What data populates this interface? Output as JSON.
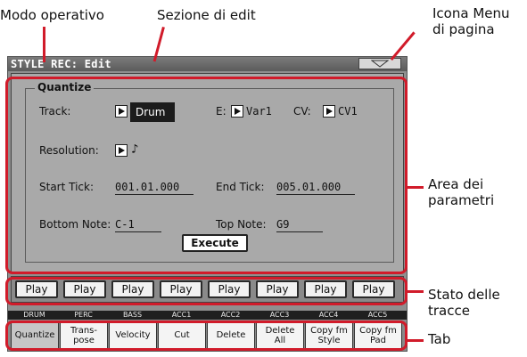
{
  "annotations": {
    "modo": "Modo operativo",
    "sezione": "Sezione di edit",
    "icona_line1": "Icona Menu",
    "icona_line2": "di pagina",
    "area_line1": "Area dei",
    "area_line2": "parametri",
    "stato_line1": "Stato delle",
    "stato_line2": "tracce",
    "tab": "Tab"
  },
  "colors": {
    "callout": "#d11b2a",
    "screen_bg": "#a9a9a9",
    "title_bg": "#6a6a6a"
  },
  "window": {
    "title": "STYLE REC: Edit",
    "menu_icon": "triangle-down-icon"
  },
  "quantize": {
    "group_title": "Quantize",
    "track_label": "Track:",
    "track_value": "Drum",
    "e_label": "E:",
    "e_value": "Var1",
    "cv_label": "CV:",
    "cv_value": "CV1",
    "resolution_label": "Resolution:",
    "resolution_value": "♪",
    "start_tick_label": "Start Tick:",
    "start_tick_value": "001.01.000",
    "end_tick_label": "End Tick:",
    "end_tick_value": "005.01.000",
    "bottom_note_label": "Bottom Note:",
    "bottom_note_value": "C-1",
    "top_note_label": "Top Note:",
    "top_note_value": "G9",
    "execute_label": "Execute"
  },
  "play_buttons": [
    "Play",
    "Play",
    "Play",
    "Play",
    "Play",
    "Play",
    "Play",
    "Play"
  ],
  "track_labels": [
    "DRUM",
    "PERC",
    "BASS",
    "ACC1",
    "ACC2",
    "ACC3",
    "ACC4",
    "ACC5"
  ],
  "tabs": [
    {
      "label": "Quantize"
    },
    {
      "label": "Trans-\npose"
    },
    {
      "label": "Velocity"
    },
    {
      "label": "Cut"
    },
    {
      "label": "Delete"
    },
    {
      "label": "Delete\nAll"
    },
    {
      "label": "Copy fm\nStyle"
    },
    {
      "label": "Copy fm\nPad"
    }
  ]
}
